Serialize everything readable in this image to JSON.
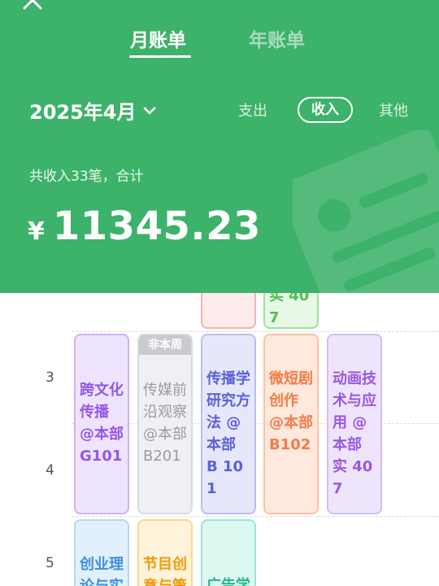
{
  "header": {
    "tabs": [
      {
        "label": "月账单",
        "active": true
      },
      {
        "label": "年账单",
        "active": false
      }
    ],
    "date_selector": "2025年4月",
    "filters": [
      "支出",
      "收入",
      "其他"
    ],
    "selected_filter": "收入",
    "summary_text": "共收入33笔，合计",
    "currency_symbol": "¥",
    "amount": "11345.23",
    "colors": {
      "header_bg": "#3db26a"
    }
  },
  "timetable": {
    "row_labels": [
      "3",
      "4",
      "5"
    ],
    "top_partial": [
      {
        "text": ""
      },
      {
        "text": "实 407"
      }
    ],
    "row_block": [
      {
        "text": "跨文化传播 @本部 G101",
        "tag": ""
      },
      {
        "text": "传媒前沿观察 @本部 B201",
        "tag": "非本周"
      },
      {
        "text": "传播学研究方法 @本部 B 101",
        "tag": ""
      },
      {
        "text": "微短剧创作 @本部 B102",
        "tag": ""
      },
      {
        "text": "动画技术与应用 @本部 实 407",
        "tag": ""
      }
    ],
    "bottom_partial": [
      {
        "text": "创业理论与实"
      },
      {
        "text": "节目创意与策"
      },
      {
        "text": "广告学"
      }
    ]
  }
}
